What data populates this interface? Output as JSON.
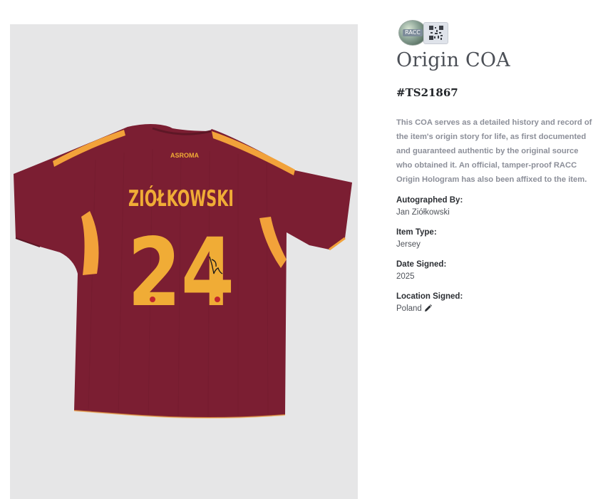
{
  "page": {
    "background": "#ffffff"
  },
  "product_image": {
    "background": "#e6e6e7",
    "jersey": {
      "brand_mark": "ASROMA",
      "player_name": "ZIÓŁKOWSKI",
      "number": "24",
      "body_color": "#7b1e32",
      "trim_color": "#f2a23a",
      "lettering_color": "#f0ac36"
    }
  },
  "badges": {
    "hologram_label": "RACC",
    "hologram_icon": "racc-hologram-icon",
    "qr_icon": "qr-code-icon"
  },
  "coa": {
    "title": "Origin COA",
    "certificate_number": "#TS21867",
    "description": "This COA serves as a detailed history and record of the item's origin story for life, as first documented and guaranteed authentic by the original source who obtained it. An official, tamper-proof RACC Origin Hologram has also been affixed to the item.",
    "fields": {
      "autographed_by": {
        "label": "Autographed By:",
        "value": "Jan Ziółkowski"
      },
      "item_type": {
        "label": "Item Type:",
        "value": "Jersey"
      },
      "date_signed": {
        "label": "Date Signed:",
        "value": "2025"
      },
      "location_signed": {
        "label": "Location Signed:",
        "value": "Poland",
        "icon": "pencil-icon"
      }
    }
  }
}
